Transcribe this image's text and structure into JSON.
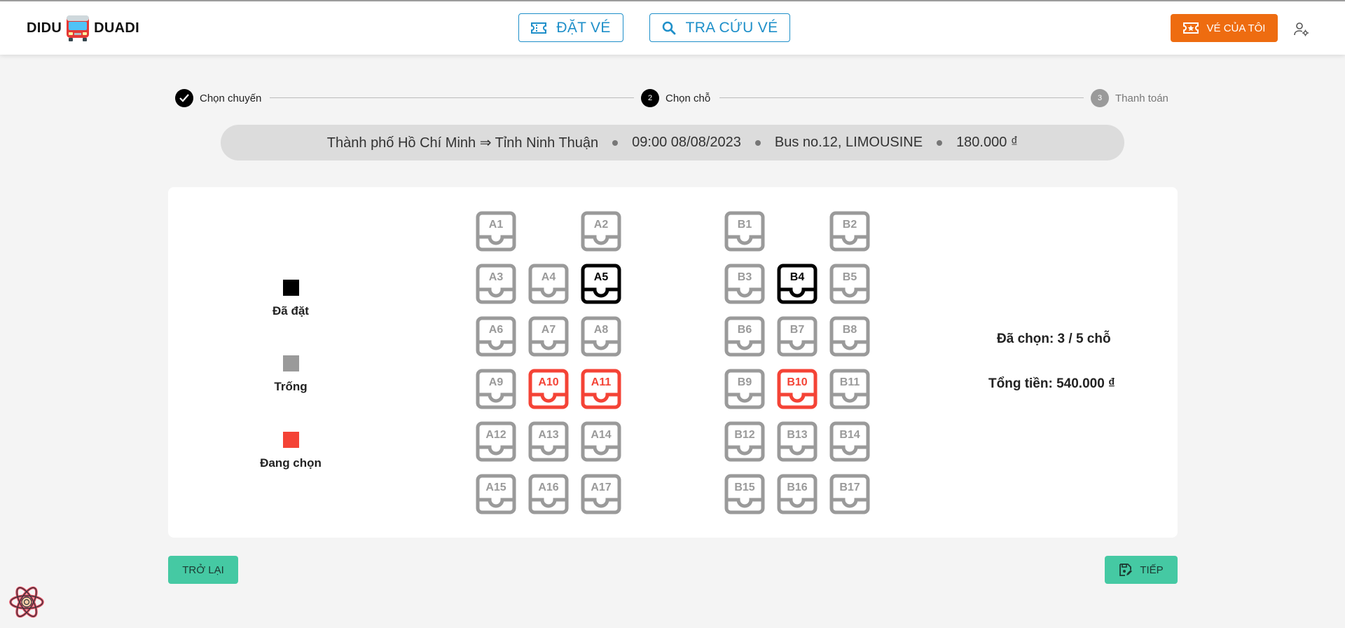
{
  "header": {
    "logo_left": "DIDU",
    "logo_right": "DUADI",
    "book_label": "ĐẶT VÉ",
    "lookup_label": "TRA CỨU VÉ",
    "my_tickets_label": "VÉ CỦA TÔI",
    "colors": {
      "primary": "#1e8fc9",
      "accent": "#ee6c10"
    }
  },
  "stepper": {
    "steps": [
      {
        "label": "Chọn chuyến",
        "state": "done",
        "icon": "check-icon"
      },
      {
        "label": "Chọn chỗ",
        "state": "active",
        "number": "2"
      },
      {
        "label": "Thanh toán",
        "state": "pending",
        "number": "3"
      }
    ]
  },
  "trip": {
    "route": "Thành phố Hồ Chí Minh ⇒ Tỉnh Ninh Thuận",
    "datetime": "09:00 08/08/2023",
    "bus": "Bus no.12, LIMOUSINE",
    "price": "180.000 ₫"
  },
  "legend": {
    "booked": "Đã đặt",
    "empty": "Trống",
    "selecting": "Đang chọn",
    "colors": {
      "booked": "#000000",
      "empty": "#9a9a9a",
      "selecting": "#f44336"
    }
  },
  "seats": {
    "deck_a": [
      {
        "id": "A1",
        "status": "empty"
      },
      {
        "id": "A2",
        "status": "empty"
      },
      {
        "id": "A3",
        "status": "empty"
      },
      {
        "id": "A4",
        "status": "empty"
      },
      {
        "id": "A5",
        "status": "booked"
      },
      {
        "id": "A6",
        "status": "empty"
      },
      {
        "id": "A7",
        "status": "empty"
      },
      {
        "id": "A8",
        "status": "empty"
      },
      {
        "id": "A9",
        "status": "empty"
      },
      {
        "id": "A10",
        "status": "selecting"
      },
      {
        "id": "A11",
        "status": "selecting"
      },
      {
        "id": "A12",
        "status": "empty"
      },
      {
        "id": "A13",
        "status": "empty"
      },
      {
        "id": "A14",
        "status": "empty"
      },
      {
        "id": "A15",
        "status": "empty"
      },
      {
        "id": "A16",
        "status": "empty"
      },
      {
        "id": "A17",
        "status": "empty"
      }
    ],
    "deck_b": [
      {
        "id": "B1",
        "status": "empty"
      },
      {
        "id": "B2",
        "status": "empty"
      },
      {
        "id": "B3",
        "status": "empty"
      },
      {
        "id": "B4",
        "status": "booked"
      },
      {
        "id": "B5",
        "status": "empty"
      },
      {
        "id": "B6",
        "status": "empty"
      },
      {
        "id": "B7",
        "status": "empty"
      },
      {
        "id": "B8",
        "status": "empty"
      },
      {
        "id": "B9",
        "status": "empty"
      },
      {
        "id": "B10",
        "status": "selecting"
      },
      {
        "id": "B11",
        "status": "empty"
      },
      {
        "id": "B12",
        "status": "empty"
      },
      {
        "id": "B13",
        "status": "empty"
      },
      {
        "id": "B14",
        "status": "empty"
      },
      {
        "id": "B15",
        "status": "empty"
      },
      {
        "id": "B16",
        "status": "empty"
      },
      {
        "id": "B17",
        "status": "empty"
      }
    ]
  },
  "summary": {
    "selected": "Đã chọn: 3 / 5 chỗ",
    "total": "Tổng tiền: 540.000 ₫"
  },
  "actions": {
    "back_label": "TRỞ LẠI",
    "next_label": "TIẾP",
    "color": "#45c9a3"
  }
}
